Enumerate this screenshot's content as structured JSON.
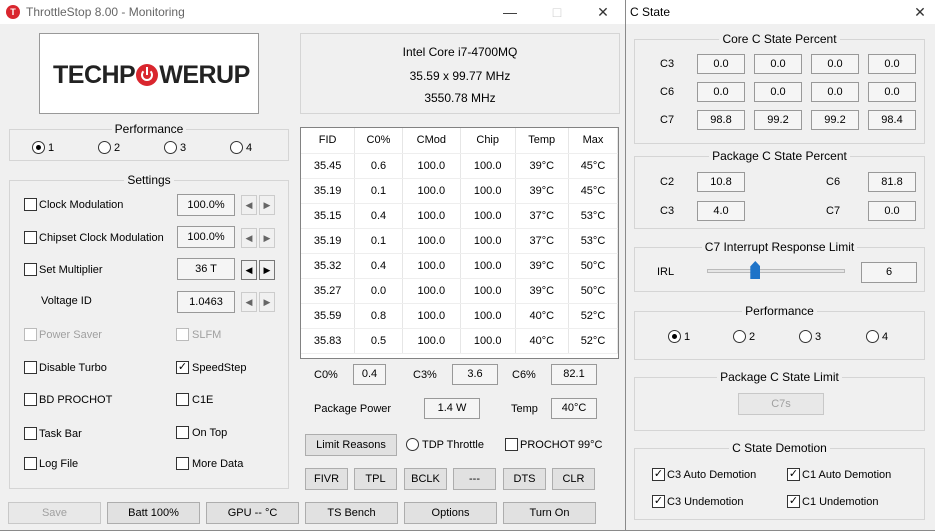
{
  "main": {
    "title": "ThrottleStop 8.00 - Monitoring",
    "logo": {
      "left": "TECHP",
      "right": "WERUP"
    },
    "cpu": {
      "name": "Intel Core i7-4700MQ",
      "mult": "35.59 x 99.77 MHz",
      "freq": "3550.78 MHz"
    },
    "performance": {
      "title": "Performance",
      "options": [
        "1",
        "2",
        "3",
        "4"
      ],
      "selected": 0
    },
    "settings": {
      "title": "Settings",
      "clock_mod": {
        "label": "Clock Modulation",
        "value": "100.0%"
      },
      "chipset_mod": {
        "label": "Chipset Clock Modulation",
        "value": "100.0%"
      },
      "set_mult": {
        "label": "Set Multiplier",
        "value": "36 T"
      },
      "voltage": {
        "label": "Voltage ID",
        "value": "1.0463"
      },
      "power_saver": "Power Saver",
      "slfm": "SLFM",
      "disable_turbo": "Disable Turbo",
      "speedstep": "SpeedStep",
      "bd_prochot": "BD PROCHOT",
      "c1e": "C1E",
      "task_bar": "Task Bar",
      "on_top": "On Top",
      "log_file": "Log File",
      "more_data": "More Data"
    },
    "table": {
      "headers": [
        "FID",
        "C0%",
        "CMod",
        "Chip",
        "Temp",
        "Max"
      ],
      "rows": [
        [
          "35.45",
          "0.6",
          "100.0",
          "100.0",
          "39°C",
          "45°C"
        ],
        [
          "35.19",
          "0.1",
          "100.0",
          "100.0",
          "39°C",
          "45°C"
        ],
        [
          "35.15",
          "0.4",
          "100.0",
          "100.0",
          "37°C",
          "53°C"
        ],
        [
          "35.19",
          "0.1",
          "100.0",
          "100.0",
          "37°C",
          "53°C"
        ],
        [
          "35.32",
          "0.4",
          "100.0",
          "100.0",
          "39°C",
          "50°C"
        ],
        [
          "35.27",
          "0.0",
          "100.0",
          "100.0",
          "39°C",
          "50°C"
        ],
        [
          "35.59",
          "0.8",
          "100.0",
          "100.0",
          "40°C",
          "52°C"
        ],
        [
          "35.83",
          "0.5",
          "100.0",
          "100.0",
          "40°C",
          "52°C"
        ]
      ]
    },
    "stats": {
      "c0_label": "C0%",
      "c0": "0.4",
      "c3_label": "C3%",
      "c3": "3.6",
      "c6_label": "C6%",
      "c6": "82.1",
      "pkg_power_label": "Package Power",
      "pkg_power": "1.4 W",
      "temp_label": "Temp",
      "temp": "40°C"
    },
    "limit_reasons": "Limit Reasons",
    "tdp_throttle": "TDP Throttle",
    "prochot": "PROCHOT 99°C",
    "small_buttons": [
      "FIVR",
      "TPL",
      "BCLK",
      "---",
      "DTS",
      "CLR"
    ],
    "bottom_buttons": [
      "Save",
      "Batt 100%",
      "GPU -- °C",
      "TS Bench",
      "Options",
      "Turn On"
    ]
  },
  "cstate": {
    "title": "C State",
    "core": {
      "title": "Core C State Percent",
      "rows": [
        {
          "label": "C3",
          "values": [
            "0.0",
            "0.0",
            "0.0",
            "0.0"
          ]
        },
        {
          "label": "C6",
          "values": [
            "0.0",
            "0.0",
            "0.0",
            "0.0"
          ]
        },
        {
          "label": "C7",
          "values": [
            "98.8",
            "99.2",
            "99.2",
            "98.4"
          ]
        }
      ]
    },
    "package": {
      "title": "Package C State Percent",
      "c2_label": "C2",
      "c2": "10.8",
      "c6_label": "C6",
      "c6": "81.8",
      "c3_label": "C3",
      "c3": "4.0",
      "c7_label": "C7",
      "c7": "0.0"
    },
    "irl": {
      "title": "C7 Interrupt Response Limit",
      "label": "IRL",
      "value": "6",
      "slider_fraction": 0.35
    },
    "performance": {
      "title": "Performance",
      "options": [
        "1",
        "2",
        "3",
        "4"
      ],
      "selected": 0
    },
    "pkg_limit": {
      "title": "Package C State Limit",
      "value": "C7s"
    },
    "demotion": {
      "title": "C State Demotion",
      "c3_auto": "C3 Auto Demotion",
      "c1_auto": "C1 Auto Demotion",
      "c3_un": "C3 Undemotion",
      "c1_un": "C1 Undemotion"
    }
  },
  "colors": {
    "accent": "#d9262e",
    "slider": "#1e73c8"
  }
}
